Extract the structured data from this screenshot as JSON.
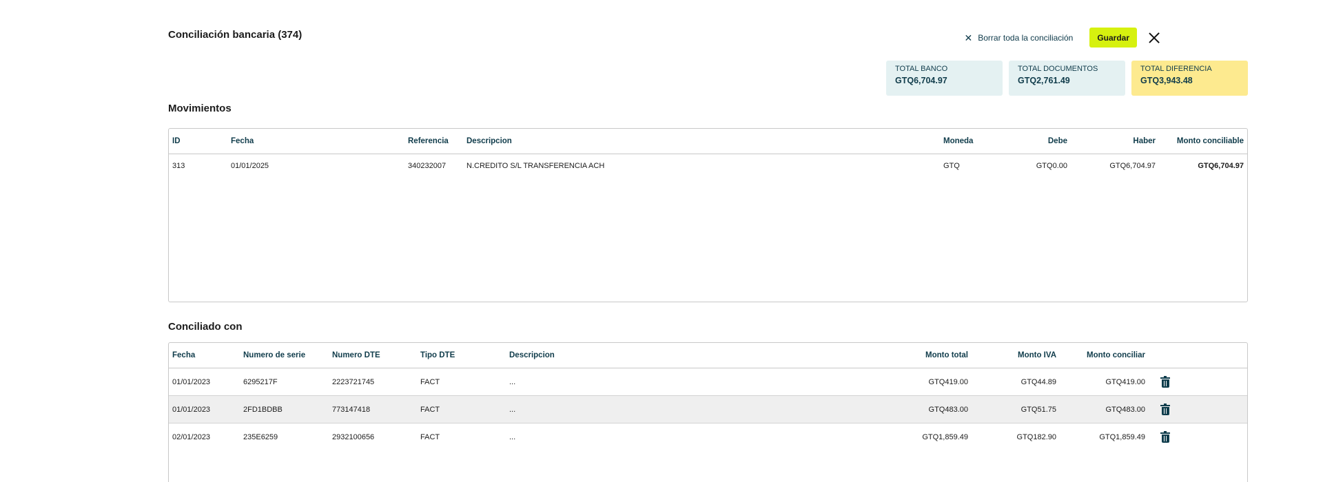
{
  "header": {
    "title": "Conciliación bancaria (374)",
    "clear_label": "Borrar toda la conciliación",
    "save_label": "Guardar"
  },
  "totals": [
    {
      "label": "TOTAL BANCO",
      "value": "GTQ6,704.97",
      "color": "#e4f1f2"
    },
    {
      "label": "TOTAL DOCUMENTOS",
      "value": "GTQ2,761.49",
      "color": "#e4f1f2"
    },
    {
      "label": "TOTAL DIFERENCIA",
      "value": "GTQ3,943.48",
      "color": "#fdea8f"
    }
  ],
  "movimientos": {
    "title": "Movimientos",
    "columns": [
      "ID",
      "Fecha",
      "Referencia",
      "Descripcion",
      "Moneda",
      "Debe",
      "Haber",
      "Monto conciliable"
    ],
    "rows": [
      [
        "313",
        "01/01/2025",
        "340232007",
        "N.CREDITO S/L TRANSFERENCIA ACH",
        "GTQ",
        "GTQ0.00",
        "GTQ6,704.97",
        "GTQ6,704.97"
      ]
    ]
  },
  "conciliado": {
    "title": "Conciliado con",
    "columns": [
      "Fecha",
      "Numero de serie",
      "Numero DTE",
      "Tipo DTE",
      "Descripcion",
      "Monto total",
      "Monto IVA",
      "Monto conciliar"
    ],
    "rows": [
      [
        "01/01/2023",
        "6295217F",
        "2223721745",
        "FACT",
        "...",
        "GTQ419.00",
        "GTQ44.89",
        "GTQ419.00"
      ],
      [
        "01/01/2023",
        "2FD1BDBB",
        "773147418",
        "FACT",
        "...",
        "GTQ483.00",
        "GTQ51.75",
        "GTQ483.00"
      ],
      [
        "02/01/2023",
        "235E6259",
        "2932100656",
        "FACT",
        "...",
        "GTQ1,859.49",
        "GTQ182.90",
        "GTQ1,859.49"
      ]
    ]
  },
  "icons": {
    "clear": "close-small-icon",
    "close": "close-icon",
    "delete": "trash-icon"
  }
}
